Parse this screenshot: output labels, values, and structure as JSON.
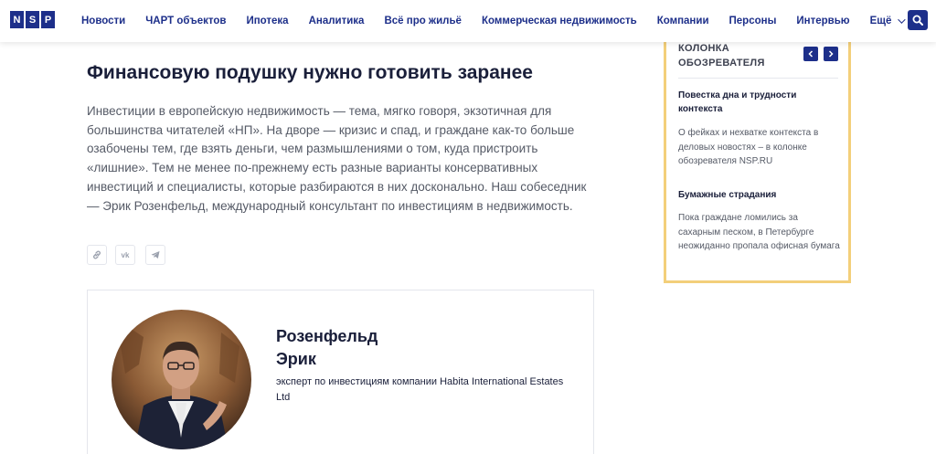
{
  "header": {
    "logo_letters": [
      "N",
      "S",
      "P"
    ],
    "nav": [
      "Новости",
      "ЧАРТ объектов",
      "Ипотека",
      "Аналитика",
      "Всё про жильё",
      "Коммерческая недвижимость",
      "Компании",
      "Персоны",
      "Интервью"
    ],
    "more_label": "Ещё",
    "search_icon": "search-icon",
    "accent_color": "#1d2f8a"
  },
  "article": {
    "title": "Финансовую подушку нужно готовить заранее",
    "lead": "Инвестиции в европейскую недвижимость — тема, мягко говоря, экзотичная для большинства читателей «НП». На дворе — кризис и спад, и граждане как-то больше озабочены тем, где взять деньги, чем размышлениями о том, куда пристроить «лишние». Тем не менее по-прежнему есть разные варианты консервативных инвестиций и специалисты, которые разбираются в них досконально. Наш собеседник — Эрик Розенфельд, международный консультант по инвестициям в недвижимость.",
    "share": [
      {
        "name": "link-icon"
      },
      {
        "name": "vk-icon",
        "label": "vk"
      },
      {
        "name": "telegram-icon"
      }
    ]
  },
  "expert": {
    "last_name": "Розенфельд",
    "first_name": "Эрик",
    "role": "эксперт по инвестициям компании Habita International Estates Ltd"
  },
  "sidebar": {
    "heading_line1": "КОЛОНКА",
    "heading_line2": "ОБОЗРЕВАТЕЛЯ",
    "border_color": "#f3cf7a",
    "items": [
      {
        "title": "Повестка дна и трудности контекста",
        "text": "О фейках и нехватке контекста в деловых новостях – в колонке обозревателя NSP.RU"
      },
      {
        "title": "Бумажные страдания",
        "text": "Пока граждане ломились за сахарным песком, в Петербурге неожиданно пропала офисная бумага"
      }
    ]
  }
}
